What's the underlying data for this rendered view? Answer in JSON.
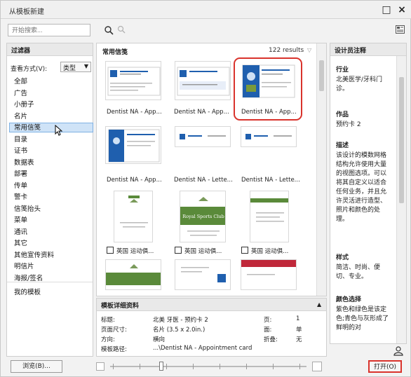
{
  "window": {
    "title": "从模板新建",
    "maximize_symbol": "□",
    "close_symbol": "×"
  },
  "search": {
    "placeholder": "开始搜索..."
  },
  "filter_panel": {
    "header": "过滤器",
    "view_label": "查看方式(V):",
    "view_value": "类型",
    "categories": [
      "全部",
      "广告",
      "小册子",
      "名片",
      "常用信笺",
      "目录",
      "证书",
      "数据表",
      "部署",
      "传单",
      "警卡",
      "信笺抬头",
      "菜单",
      "通讯",
      "其它",
      "其他宣传资料",
      "明信片",
      "海报/签名"
    ],
    "selected_category": "常用信笺",
    "my_templates": "我的模板"
  },
  "gallery": {
    "header": "常用信笺",
    "results": "122 results",
    "labels": [
      "Dentist NA - App...",
      "Dentist NA - App...",
      "Dentist NA - App...",
      "Dentist NA - App...",
      "Dentist NA - Lette...",
      "Dentist NA - Lette...",
      "英国 运动俱...",
      "英国 运动俱...",
      "英国 运动俱..."
    ],
    "club_name": "Royal Sports Club"
  },
  "details": {
    "header": "模板详细资料",
    "rows": [
      {
        "k": "标题:",
        "v": "北美 牙医 - 预约卡 2",
        "k2": "页:",
        "v2": "1"
      },
      {
        "k": "页面尺寸:",
        "v": "名片 (3.5 x 2.0in.)",
        "k2": "面:",
        "v2": "单"
      },
      {
        "k": "方向:",
        "v": "横向",
        "k2": "折叠:",
        "v2": "无"
      },
      {
        "k": "模板路径:",
        "v": "...\\Dentist NA - Appointment card",
        "k2": "",
        "v2": ""
      }
    ]
  },
  "designer_notes": {
    "header": "设计员注释",
    "industry_label": "行业",
    "industry_value": "北美医学/牙科门诊。",
    "work_label": "作品",
    "work_value": "预约卡 2",
    "desc_label": "描述",
    "desc_value": "该设计的模数网格结构允许使用大量的视图选项。可以将其自定义以适合任何业务，并且允许灵活进行造型、照片和颜色的处理。",
    "style_label": "样式",
    "style_value": "简洁、时尚、便切、专业。",
    "color_label": "颜色选择",
    "color_value": "紫色和绿色是该定色;青色与灰形成了鲜明的对"
  },
  "buttons": {
    "browse": "浏览(B)...",
    "open": "打开(O)"
  },
  "colors": {
    "highlight": "#d9332c",
    "selection": "#cfe3f7",
    "dentist_blue": "#1f5fae",
    "club_green": "#5a8a3a"
  }
}
